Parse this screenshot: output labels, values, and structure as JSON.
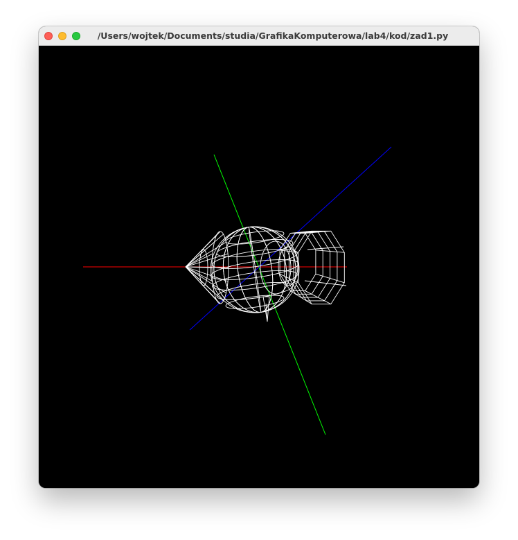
{
  "window": {
    "title": "/Users/wojtek/Documents/studia/GrafikaKomputerowa/lab4/kod/zad1.py",
    "controls": [
      "close",
      "minimize",
      "zoom"
    ]
  },
  "scene": {
    "background": "#000000",
    "axes": [
      {
        "name": "x-axis",
        "color": "#ff0000"
      },
      {
        "name": "y-axis",
        "color": "#00ff00"
      },
      {
        "name": "z-axis",
        "color": "#0000ff"
      }
    ],
    "object": {
      "render_mode": "wireframe",
      "color": "#ffffff",
      "parts": [
        "cone-tip",
        "sphere-body",
        "octagonal-prism"
      ]
    }
  }
}
